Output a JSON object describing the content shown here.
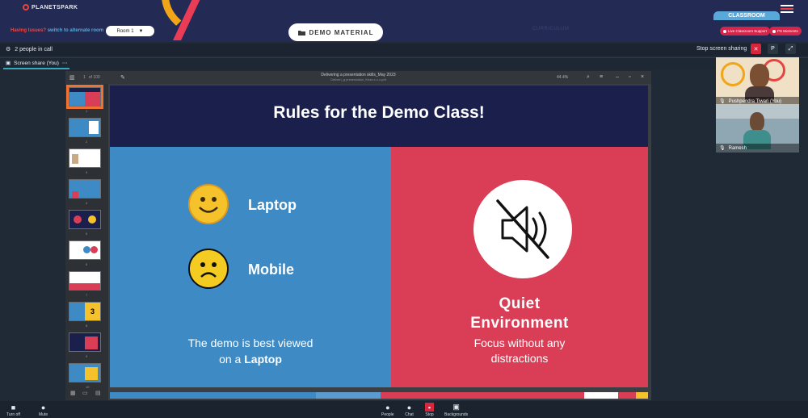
{
  "header": {
    "brand": "PLANETSPARK",
    "classroom_tab": "CLASSROOM",
    "issues_text": "Having Issues?",
    "alternate_room_link": "switch to alternate room",
    "room_select": "Room 1",
    "demo_button": "DEMO MATERIAL",
    "curriculum": "CURRICULUM",
    "support_pill": "Live Classroom Support",
    "moments_pill": "PS Moments"
  },
  "call": {
    "people_count": "2 people in call",
    "stop_sharing": "Stop screen sharing",
    "p_button": "P",
    "share_tab": "Screen share (You)",
    "share_menu": "⋯"
  },
  "pdf": {
    "doc_title": "Delivering a presentation skills_May 2023",
    "doc_subtitle": "Deliveri_g presentation_Khan.c.c.c.pdf",
    "page_current": "1",
    "page_total": "of 100",
    "zoom": "44.4%"
  },
  "slide": {
    "title": "Rules for the Demo Class!",
    "laptop": "Laptop",
    "mobile": "Mobile",
    "caption_line1": "The demo is best viewed",
    "caption_line2_prefix": "on a ",
    "caption_line2_bold": "Laptop",
    "quiet_line1": "Quiet",
    "quiet_line2": "Environment",
    "focus_line1": "Focus without any",
    "focus_line2": "distractions"
  },
  "thumbnails": [
    "1",
    "2",
    "3",
    "4",
    "5",
    "6",
    "7",
    "8",
    "9",
    "10"
  ],
  "participants": [
    {
      "name": "Pushpendra Tiwari (You)"
    },
    {
      "name": "Ramesh"
    }
  ],
  "toolbar": {
    "turn_off": "Turn off",
    "mute": "Mute",
    "people": "People",
    "chat": "Chat",
    "stop": "Stop",
    "backgrounds": "Backgrounds"
  },
  "colors": {
    "header_bg": "#232a54",
    "slide_navy": "#1b1f4b",
    "panel_blue": "#3e8ac4",
    "panel_red": "#d93e56",
    "accent_orange": "#f07233"
  }
}
